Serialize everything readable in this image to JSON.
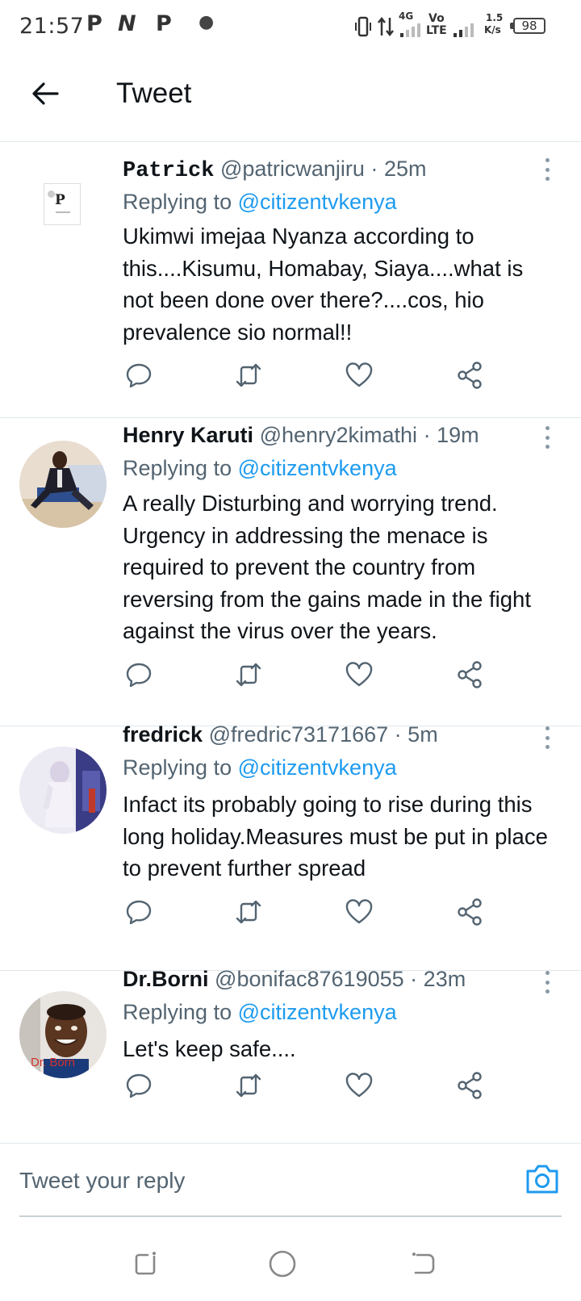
{
  "status_bar": {
    "time": "21:57",
    "notif_icons": [
      "P",
      "N",
      "P"
    ],
    "net_4g": "4G",
    "volte": "Vo\nLTE",
    "speed_value": "1.5",
    "speed_unit": "K/s",
    "battery": "98"
  },
  "header": {
    "title": "Tweet"
  },
  "tweets": [
    {
      "name": "Patrick",
      "handle": "@patricwanjiru",
      "time": "25m",
      "replying_prefix": "Replying to",
      "replying_to": "@citizentvkenya",
      "text": "Ukimwi imejaa Nyanza according to this....Kisumu, Homabay, Siaya....what is not been done over there?....cos, hio prevalence sio normal!!",
      "avatar_letter": "P"
    },
    {
      "name": "Henry Karuti",
      "handle": "@henry2kimathi",
      "time": "19m",
      "replying_prefix": "Replying to",
      "replying_to": "@citizentvkenya",
      "text": "A really Disturbing and worrying trend. Urgency in addressing the menace is required to prevent the country from reversing from the gains made in the fight against the virus over the years."
    },
    {
      "name": "fredrick",
      "handle": "@fredric73171667",
      "time": "5m",
      "replying_prefix": "Replying to",
      "replying_to": "@citizentvkenya",
      "text": "Infact its probably going to rise during this long holiday.Measures must be put in place to prevent further spread"
    },
    {
      "name": "Dr.Borni",
      "handle": "@bonifac87619055",
      "time": "23m",
      "replying_prefix": "Replying to",
      "replying_to": "@citizentvkenya",
      "text": "Let's keep safe....",
      "avatar_caption": "Dr. Born"
    }
  ],
  "separator": "·",
  "reply_bar": {
    "placeholder": "Tweet your reply"
  },
  "colors": {
    "accent": "#1d9bf0",
    "secondary_text": "#536471",
    "divider": "#e1e8ed"
  }
}
